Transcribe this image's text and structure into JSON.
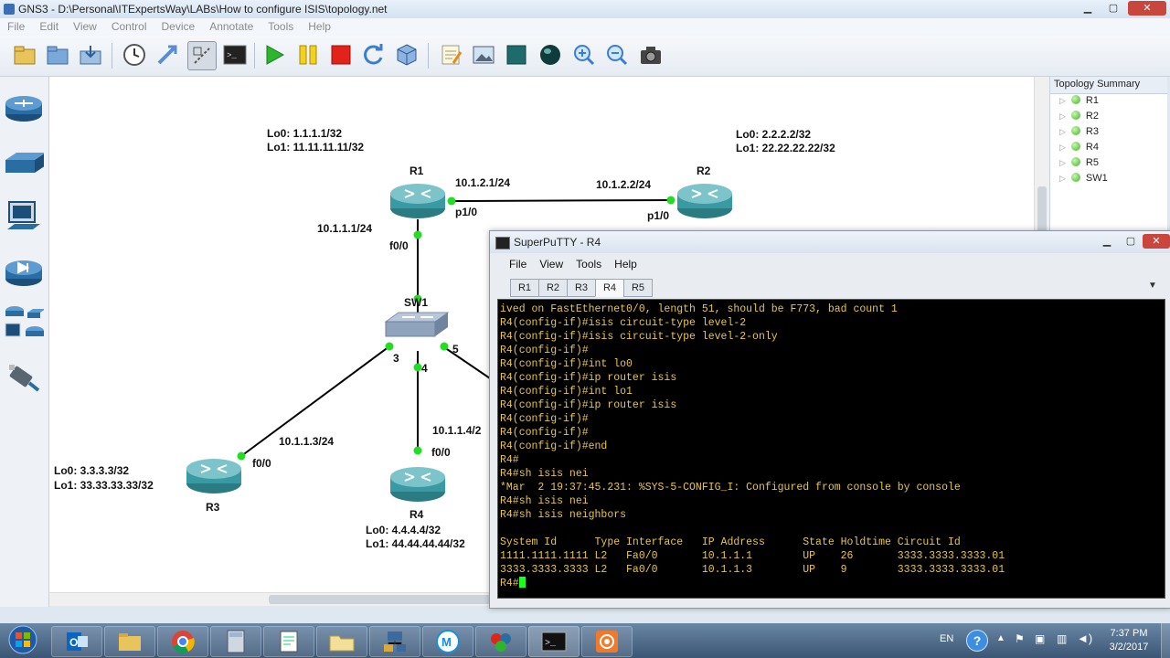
{
  "window": {
    "title": "GNS3 - D:\\Personal\\ITExpertsWay\\LABs\\How to configure ISIS\\topology.net",
    "min": "▁",
    "max": "▢",
    "close": "✕"
  },
  "menu": [
    "File",
    "Edit",
    "View",
    "Control",
    "Device",
    "Annotate",
    "Tools",
    "Help"
  ],
  "toolbar_icons": [
    "new-project-icon",
    "open-project-icon",
    "save-project-icon",
    "snapshot-icon",
    "topology-dock-icon",
    "capture-icon",
    "console-icon",
    "start-icon",
    "pause-icon",
    "stop-icon",
    "reload-icon",
    "virtualbox-icon",
    "note-icon",
    "picture-icon",
    "rectangle-icon",
    "ellipse-icon",
    "zoom-in-icon",
    "zoom-out-icon",
    "screenshot-icon"
  ],
  "palette": [
    "router-icon",
    "switch-icon",
    "end-device-icon",
    "security-device-icon",
    "all-devices-icon",
    "cable-icon"
  ],
  "topology": {
    "r1_loopbacks": [
      "Lo0: 1.1.1.1/32",
      "Lo1: 11.11.11.11/32"
    ],
    "r2_loopbacks": [
      "Lo0: 2.2.2.2/32",
      "Lo1: 22.22.22.22/32"
    ],
    "r3_loopbacks": [
      "Lo0: 3.3.3.3/32",
      "Lo1: 33.33.33.33/32"
    ],
    "r4_loopbacks": [
      "Lo0: 4.4.4.4/32",
      "Lo1: 44.44.44.44/32"
    ],
    "nodes": {
      "r1": "R1",
      "r2": "R2",
      "r3": "R3",
      "r4": "R4",
      "sw1": "SW1"
    },
    "links": {
      "r1_r2_ip_r1": "10.1.2.1/24",
      "r1_r2_ip_r2": "10.1.2.2/24",
      "r1_if_p1": "p1/0",
      "r2_if_p1": "p1/0",
      "r1_sw_ip": "10.1.1.1/24",
      "r1_if_f0": "f0/0",
      "r3_ip": "10.1.1.3/24",
      "r3_if": "f0/0",
      "r4_ip": "10.1.1.4/2",
      "r4_if": "f0/0",
      "sw_port3": "3",
      "sw_port4": "4",
      "sw_port5": "5"
    }
  },
  "topology_summary": {
    "title": "Topology Summary",
    "items": [
      "R1",
      "R2",
      "R3",
      "R4",
      "R5",
      "SW1"
    ]
  },
  "putty": {
    "title": "SuperPuTTY - R4",
    "menu": [
      "File",
      "View",
      "Tools",
      "Help"
    ],
    "tabs": [
      "R1",
      "R2",
      "R3",
      "R4",
      "R5"
    ],
    "active_tab": "R4",
    "terminal_lines": [
      "ived on FastEthernet0/0, length 51, should be F773, bad count 1",
      "R4(config-if)#isis circuit-type level-2",
      "R4(config-if)#isis circuit-type level-2-only",
      "R4(config-if)#",
      "R4(config-if)#int lo0",
      "R4(config-if)#ip router isis",
      "R4(config-if)#int lo1",
      "R4(config-if)#ip router isis",
      "R4(config-if)#",
      "R4(config-if)#",
      "R4(config-if)#end",
      "R4#",
      "R4#sh isis nei",
      "*Mar  2 19:37:45.231: %SYS-5-CONFIG_I: Configured from console by console",
      "R4#sh isis nei",
      "R4#sh isis neighbors",
      "",
      "System Id      Type Interface   IP Address      State Holdtime Circuit Id",
      "1111.1111.1111 L2   Fa0/0       10.1.1.1        UP    26       3333.3333.3333.01",
      "3333.3333.3333 L2   Fa0/0       10.1.1.3        UP    9        3333.3333.3333.01"
    ],
    "prompt": "R4#"
  },
  "taskbar": {
    "apps": [
      "start-orb-icon",
      "outlook-icon",
      "file-explorer-icon",
      "chrome-icon",
      "calculator-icon",
      "notepad-icon",
      "folder-icon",
      "network-icon",
      "maxthon-icon",
      "paint-icon",
      "cmd-icon",
      "screen-recorder-icon"
    ],
    "lang": "EN",
    "time": "7:37 PM",
    "date": "3/2/2017"
  },
  "colors": {
    "terminal_text": "#e7c547",
    "terminal_bg": "#000000",
    "link_dot": "#22dd22",
    "router_teal": "#3a9aa3"
  }
}
